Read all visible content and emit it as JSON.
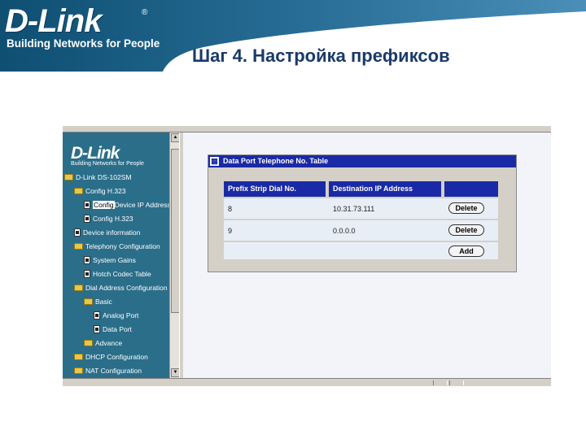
{
  "slide": {
    "logo_text": "D-Link",
    "logo_reg": "®",
    "logo_tagline": "Building Networks for People",
    "title": "Шаг 4. Настройка префиксов",
    "colors": {
      "header_dark": "#0e4f72",
      "header_light": "#4b8fb8",
      "title": "#1a3a6a"
    }
  },
  "tree_pane": {
    "logo_text": "D-Link",
    "logo_tagline": "Building Networks for People",
    "items": [
      {
        "label": "D-Link DS-102SM",
        "icon": "folder-icon"
      },
      {
        "label": "Config H.323",
        "icon": "folder-icon"
      },
      {
        "label": "Config",
        "label2": "Device IP Address",
        "icon": "page-icon"
      },
      {
        "label": "Config H.323",
        "icon": "page-icon"
      },
      {
        "label": "Device information",
        "icon": "page-icon"
      },
      {
        "label": "Telephony Configuration",
        "icon": "folder-icon"
      },
      {
        "label": "System Gains",
        "icon": "page-icon"
      },
      {
        "label": "Hotch Codec Table",
        "icon": "page-icon"
      },
      {
        "label": "Dial Address Configuration",
        "icon": "folder-icon"
      },
      {
        "label": "Basic",
        "icon": "folder-icon"
      },
      {
        "label": "Analog Port",
        "icon": "page-icon"
      },
      {
        "label": "Data Port",
        "icon": "page-icon"
      },
      {
        "label": "Advance",
        "icon": "folder-icon"
      },
      {
        "label": "DHCP Configuration",
        "icon": "folder-icon"
      },
      {
        "label": "NAT Configuration",
        "icon": "folder-icon"
      }
    ]
  },
  "panel": {
    "title": "Data Port Telephone No. Table",
    "title_icon": "table-icon",
    "columns": [
      "Prefix Strip Dial No.",
      "Destination IP Address"
    ],
    "rows": [
      {
        "prefix": "8",
        "ip": "10.31.73.111",
        "action": "Delete"
      },
      {
        "prefix": "9",
        "ip": "0.0.0.0",
        "action": "Delete"
      }
    ],
    "add_label": "Add"
  }
}
